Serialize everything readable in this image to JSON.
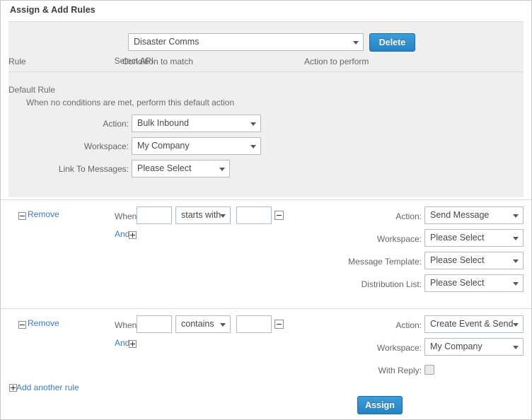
{
  "page": {
    "title": "Assign & Add Rules"
  },
  "api_section": {
    "select_api_label": "Select API",
    "select_api_value": "Disaster Comms",
    "delete_button": "Delete"
  },
  "columns": {
    "rule": "Rule",
    "condition": "Condition to match",
    "action": "Action to perform"
  },
  "default_rule": {
    "heading": "Default Rule",
    "description": "When no conditions are met, perform this default action",
    "fields": [
      {
        "label": "Action:",
        "value": "Bulk Inbound"
      },
      {
        "label": "Workspace:",
        "value": "My Company"
      },
      {
        "label": "Link To Messages:",
        "value": "Please Select"
      }
    ]
  },
  "rules": [
    {
      "remove_label": "Remove",
      "when_label": "When",
      "field_value": "",
      "operator": "starts with",
      "match_value": "",
      "and_label": "And",
      "actions": [
        {
          "label": "Action:",
          "value": "Send Message"
        },
        {
          "label": "Workspace:",
          "value": "Please Select"
        },
        {
          "label": "Message Template:",
          "value": "Please Select"
        },
        {
          "label": "Distribution List:",
          "value": "Please Select"
        }
      ]
    },
    {
      "remove_label": "Remove",
      "when_label": "When",
      "field_value": "",
      "operator": "contains",
      "match_value": "",
      "and_label": "And",
      "actions": [
        {
          "label": "Action:",
          "value": "Create Event & Send"
        },
        {
          "label": "Workspace:",
          "value": "My Company"
        }
      ],
      "with_reply_label": "With Reply:",
      "with_reply_checked": false
    }
  ],
  "footer": {
    "add_rule_label": "Add another rule",
    "assign_button": "Assign"
  },
  "colors": {
    "accent": "#3a7cbf",
    "button": "#2784c4",
    "panel_bg": "#efefef",
    "field_border": "#a9bcc9"
  }
}
